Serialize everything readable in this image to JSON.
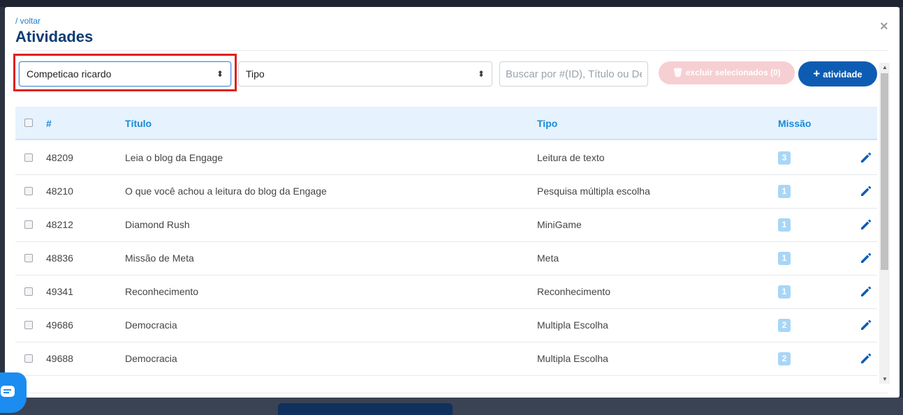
{
  "modal": {
    "back_label": "/ voltar",
    "title": "Atividades",
    "close_label": "×"
  },
  "filters": {
    "competition_value": "Competicao ricardo",
    "type_value": "Tipo",
    "search_placeholder": "Buscar por #(ID), Título ou Descrição",
    "delete_label": "excluir selecionados (0)",
    "add_label": "atividade"
  },
  "table": {
    "headers": {
      "id": "#",
      "title": "Título",
      "type": "Tipo",
      "mission": "Missão"
    },
    "rows": [
      {
        "id": "48209",
        "title": "Leia o blog da Engage",
        "type": "Leitura de texto",
        "mission": "3"
      },
      {
        "id": "48210",
        "title": "O que você achou a leitura do blog da Engage",
        "type": "Pesquisa múltipla escolha",
        "mission": "1"
      },
      {
        "id": "48212",
        "title": "Diamond Rush",
        "type": "MiniGame",
        "mission": "1"
      },
      {
        "id": "48836",
        "title": "Missão de Meta",
        "type": "Meta",
        "mission": "1"
      },
      {
        "id": "49341",
        "title": "Reconhecimento",
        "type": "Reconhecimento",
        "mission": "1"
      },
      {
        "id": "49686",
        "title": "Democracia",
        "type": "Multipla Escolha",
        "mission": "2"
      },
      {
        "id": "49688",
        "title": "Democracia",
        "type": "Multipla Escolha",
        "mission": "2"
      }
    ]
  },
  "colors": {
    "primary": "#0d5cb3",
    "header_text": "#1a8ad8",
    "highlight": "#e02020",
    "badge": "#a8d6f7"
  }
}
